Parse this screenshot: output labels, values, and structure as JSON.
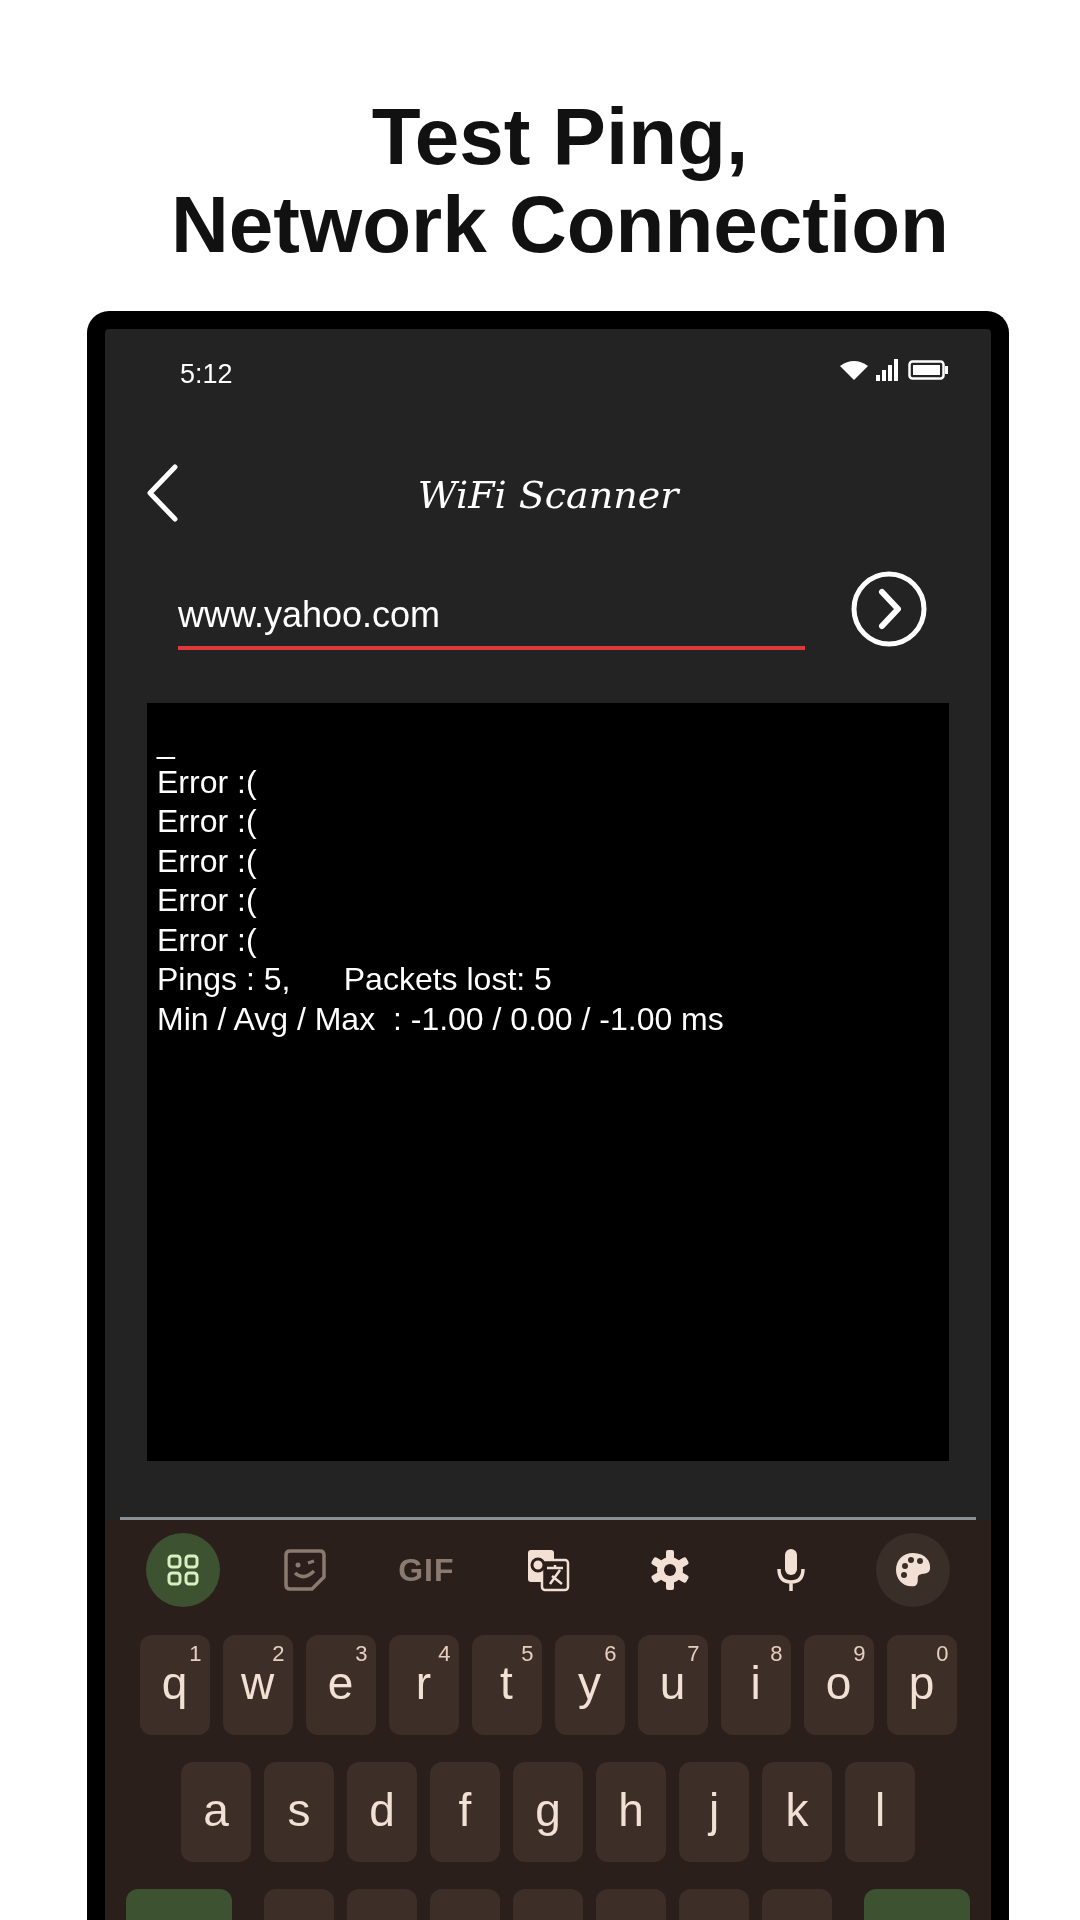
{
  "headline": [
    "Test Ping,",
    "Network Connection"
  ],
  "status_bar": {
    "time": "5:12"
  },
  "app_bar": {
    "title": "WiFi Scanner"
  },
  "host_field": {
    "value": "www.yahoo.com"
  },
  "console": {
    "lines": [
      "_",
      "Error :(",
      "Error :(",
      "Error :(",
      "Error :(",
      "Error :(",
      "Pings : 5,      Packets lost: 5",
      "Min / Avg / Max  : -1.00 / 0.00 / -1.00 ms"
    ]
  },
  "keyboard": {
    "toolbar": [
      {
        "kind": "apps",
        "selected": true
      },
      {
        "kind": "sticker",
        "selected": false
      },
      {
        "kind": "gif",
        "label": "GIF",
        "selected": false
      },
      {
        "kind": "translate",
        "selected": false
      },
      {
        "kind": "settings",
        "selected": false
      },
      {
        "kind": "mic",
        "selected": false
      },
      {
        "kind": "palette",
        "selected": false
      }
    ],
    "rows": [
      {
        "keys": [
          {
            "kind": "letter",
            "label": "q",
            "hint": "1"
          },
          {
            "kind": "letter",
            "label": "w",
            "hint": "2"
          },
          {
            "kind": "letter",
            "label": "e",
            "hint": "3"
          },
          {
            "kind": "letter",
            "label": "r",
            "hint": "4"
          },
          {
            "kind": "letter",
            "label": "t",
            "hint": "5"
          },
          {
            "kind": "letter",
            "label": "y",
            "hint": "6"
          },
          {
            "kind": "letter",
            "label": "u",
            "hint": "7"
          },
          {
            "kind": "letter",
            "label": "i",
            "hint": "8"
          },
          {
            "kind": "letter",
            "label": "o",
            "hint": "9"
          },
          {
            "kind": "letter",
            "label": "p",
            "hint": "0"
          }
        ]
      },
      {
        "keys": [
          {
            "kind": "letter",
            "label": "a"
          },
          {
            "kind": "letter",
            "label": "s"
          },
          {
            "kind": "letter",
            "label": "d"
          },
          {
            "kind": "letter",
            "label": "f"
          },
          {
            "kind": "letter",
            "label": "g"
          },
          {
            "kind": "letter",
            "label": "h"
          },
          {
            "kind": "letter",
            "label": "j"
          },
          {
            "kind": "letter",
            "label": "k"
          },
          {
            "kind": "letter",
            "label": "l"
          }
        ]
      },
      {
        "keys": [
          {
            "kind": "shift"
          },
          {
            "kind": "letter"
          },
          {
            "kind": "letter"
          },
          {
            "kind": "letter"
          },
          {
            "kind": "letter"
          },
          {
            "kind": "letter"
          },
          {
            "kind": "letter"
          },
          {
            "kind": "letter"
          },
          {
            "kind": "enter"
          }
        ]
      }
    ]
  }
}
